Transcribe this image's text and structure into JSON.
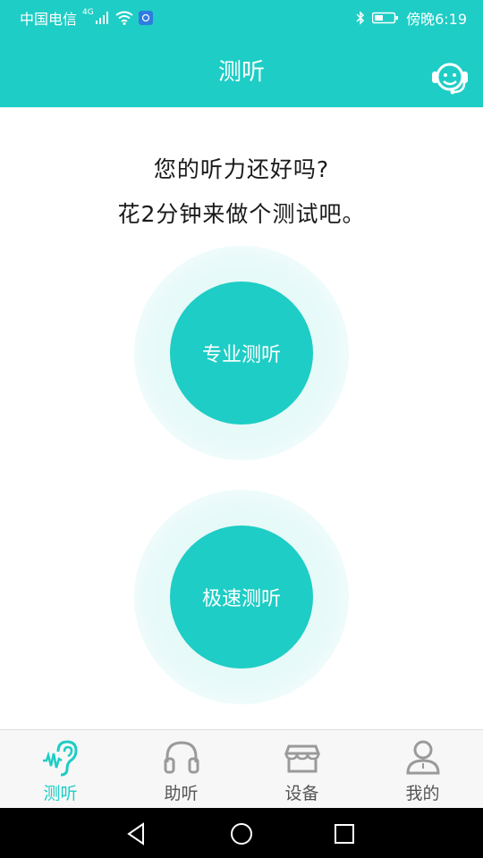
{
  "status_bar": {
    "carrier": "中国电信",
    "network": "4G",
    "time": "傍晚6:19"
  },
  "app_bar": {
    "title": "测听"
  },
  "main": {
    "headline_line1": "您的听力还好吗?",
    "headline_line2": "花2分钟来做个测试吧。",
    "professional_test_label": "专业测听",
    "quick_test_label": "极速测听"
  },
  "bottom_nav": {
    "items": [
      {
        "label": "测听",
        "icon": "ear-icon",
        "active": true
      },
      {
        "label": "助听",
        "icon": "headphones-icon",
        "active": false
      },
      {
        "label": "设备",
        "icon": "store-icon",
        "active": false
      },
      {
        "label": "我的",
        "icon": "user-icon",
        "active": false
      }
    ]
  },
  "colors": {
    "accent": "#1ecdc5",
    "text": "#1a1a1a",
    "inactive": "#9a9a9a"
  }
}
